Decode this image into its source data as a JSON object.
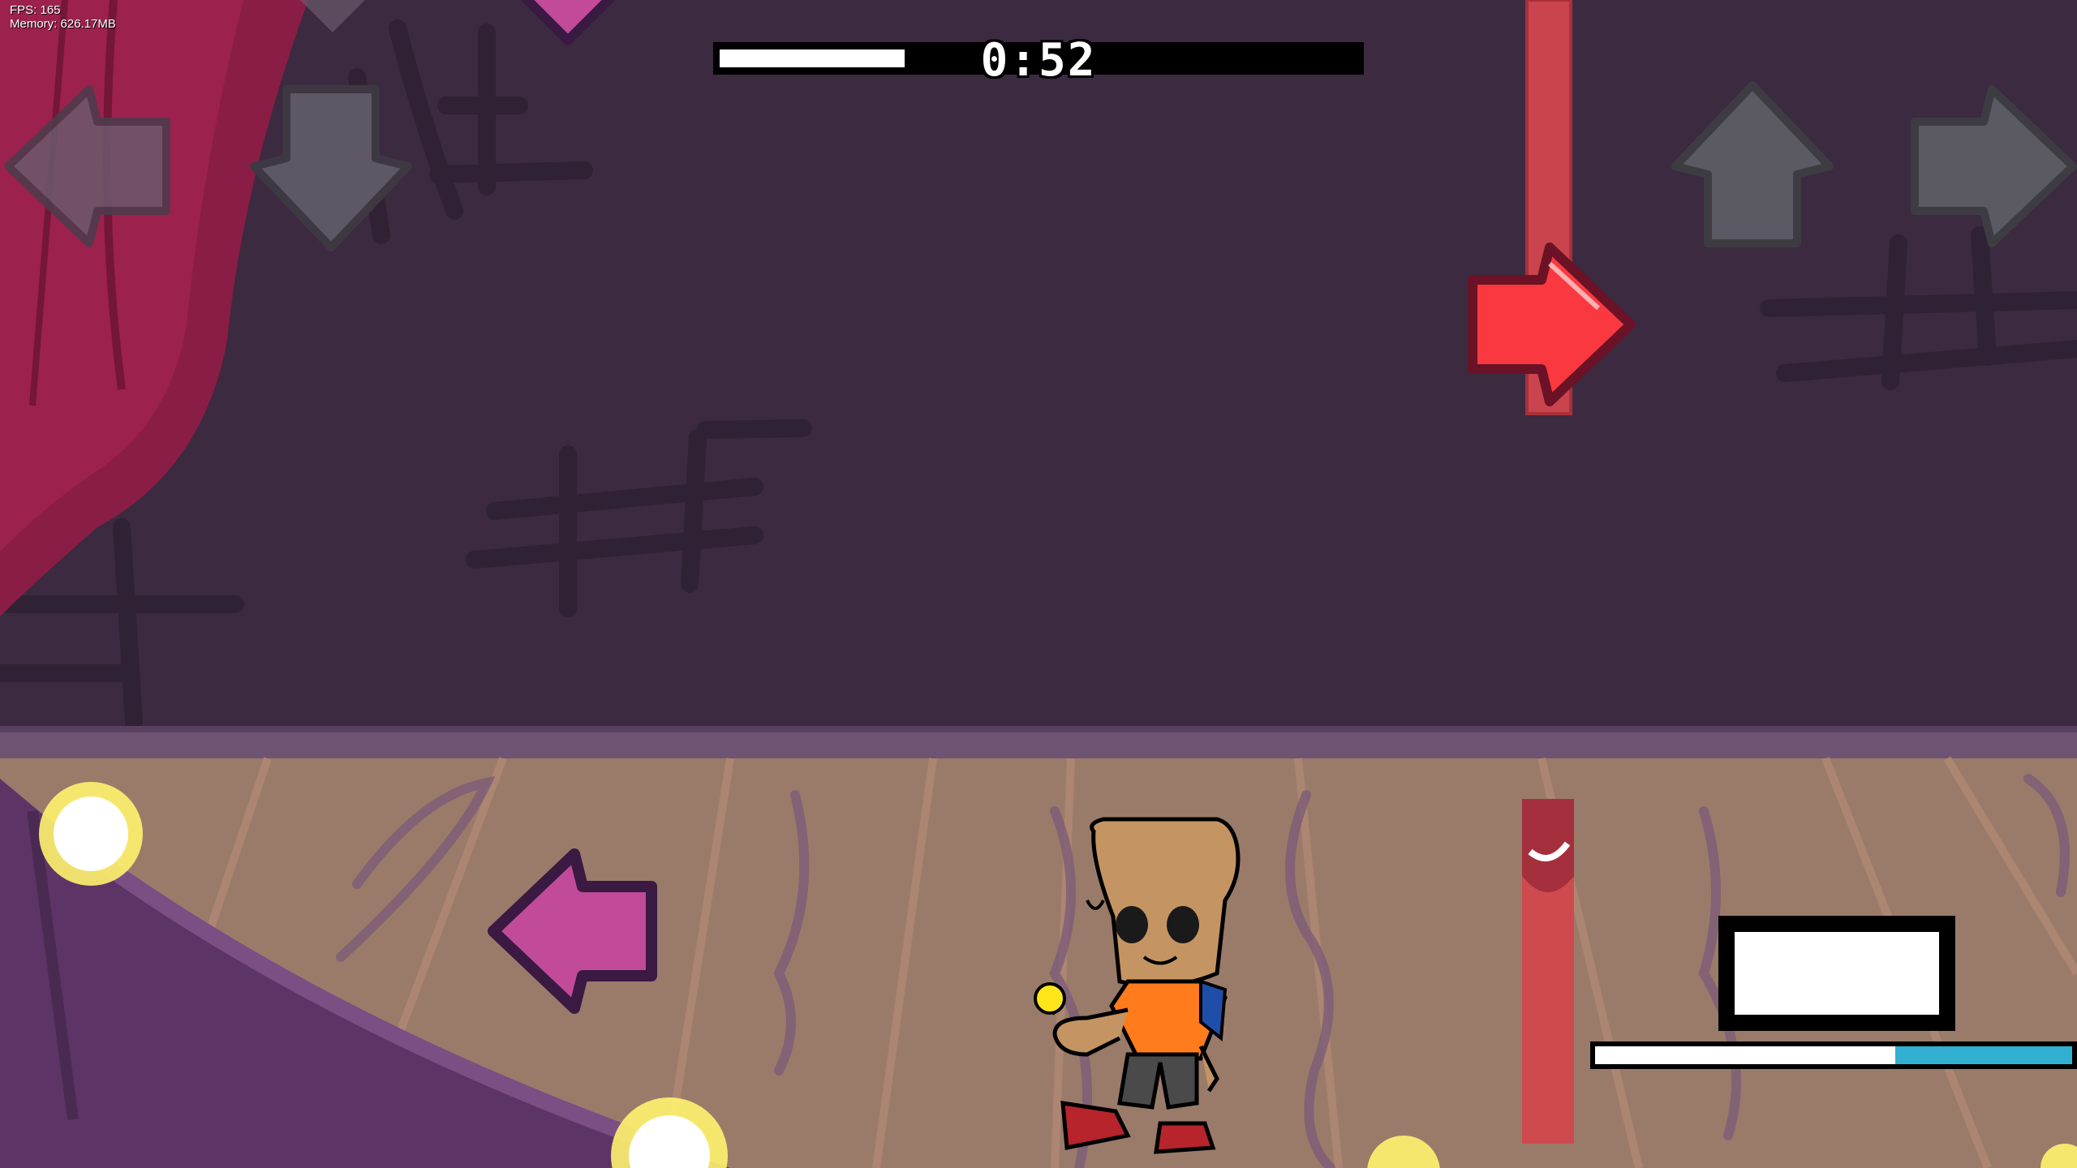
{
  "hud": {
    "fps_text": "FPS: 165",
    "memory_text": "Memory: 626.17MB",
    "time_remaining": "0:52",
    "song_progress": 0.29,
    "health_player_share": 0.37
  },
  "strums": {
    "opponent": [
      "left-arrow",
      "down-arrow",
      "up-arrow",
      "right-arrow"
    ],
    "player": [
      "up-arrow",
      "right-arrow"
    ]
  },
  "notes": [
    {
      "direction": "right",
      "color": "red"
    },
    {
      "direction": "left",
      "color": "purple"
    },
    {
      "direction": "down",
      "color": "purple"
    }
  ],
  "colors": {
    "background_wall": "#3b2a40",
    "floor": "#9a7b6a",
    "strum_gray": "#5c5a64",
    "note_left_purple": "#c24b99",
    "note_right_red": "#f9393f",
    "hold_red": "#cf4a4f",
    "health_player": "#31b0d1",
    "health_opponent": "#ffffff",
    "glow_yellow": "#fff36e"
  },
  "character": {
    "description_icon": "paper-bag-kid-with-lollipop"
  }
}
